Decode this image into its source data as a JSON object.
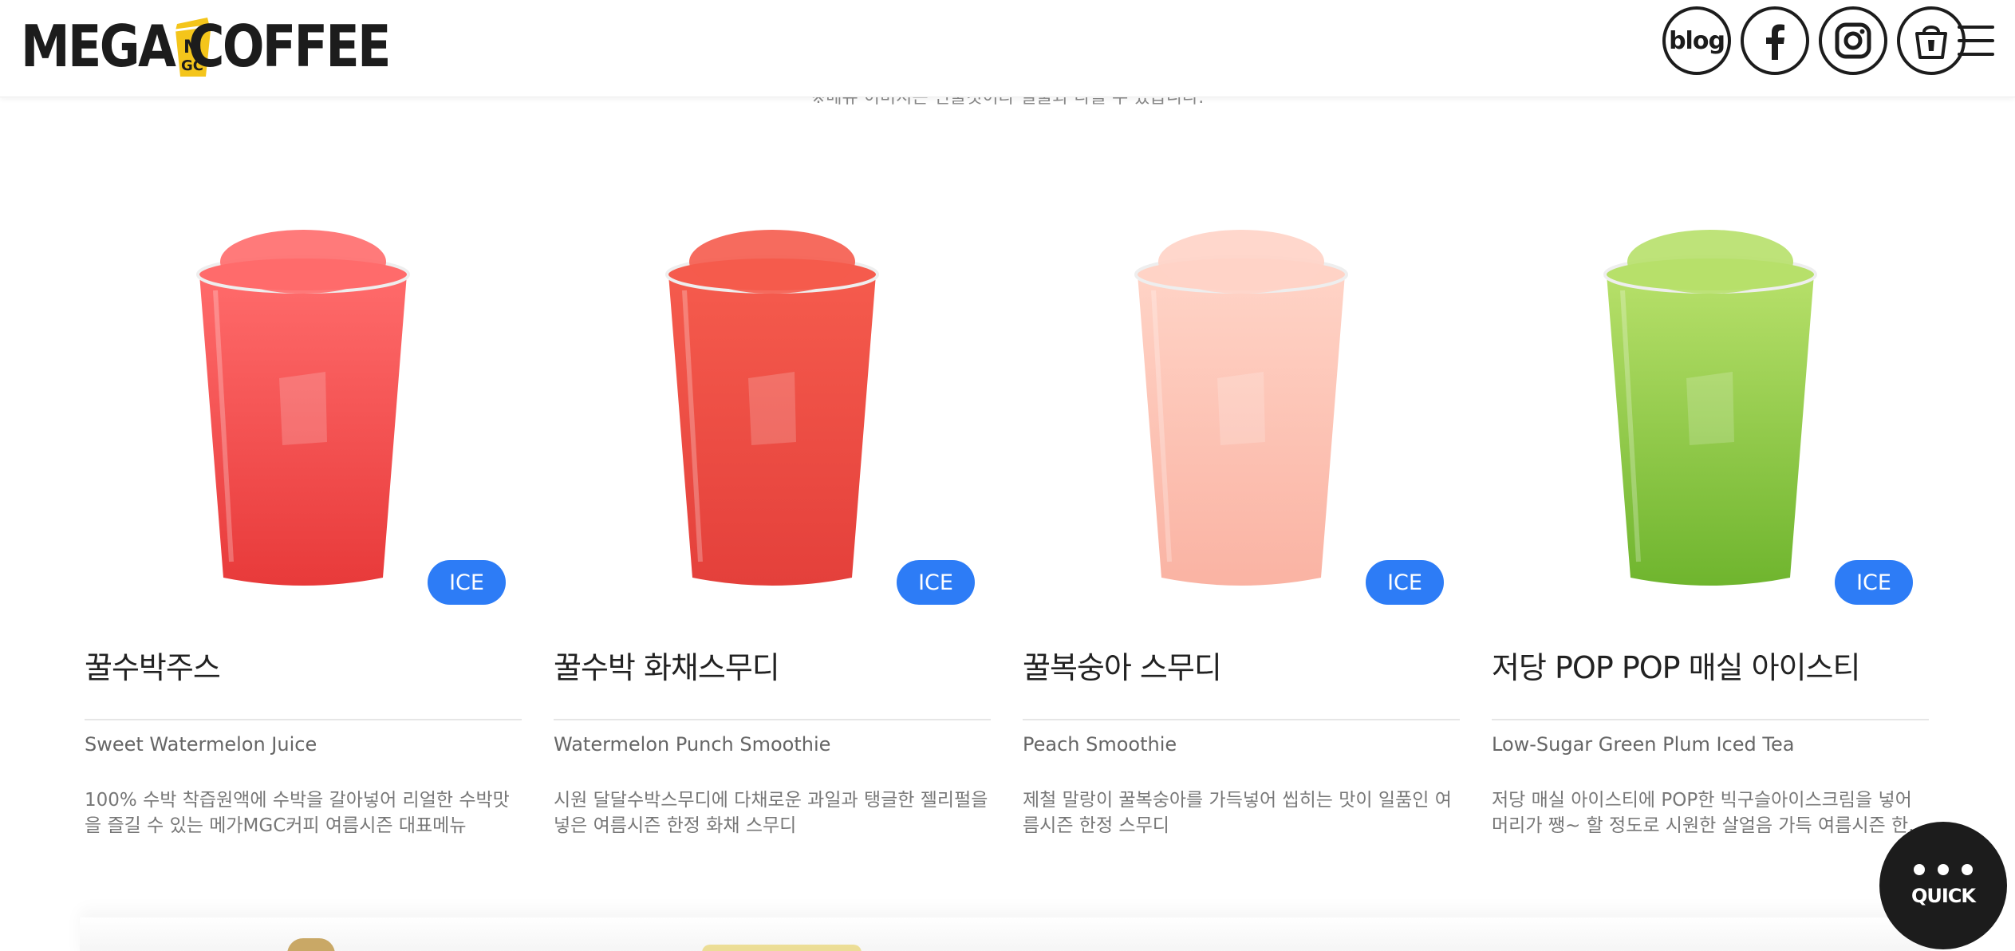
{
  "header": {
    "logo_left": "MEGA",
    "logo_right": "COFFEE",
    "logo_mark_text": "MGC",
    "blog_label": "blog",
    "icons": [
      "blog-icon",
      "facebook-icon",
      "instagram-icon",
      "cart-icon",
      "hamburger-menu-icon"
    ]
  },
  "notice": "※메뉴 이미지는 연출컷이라 실물과 다를 수 있습니다.",
  "products": [
    {
      "badge": "ICE",
      "name_ko": "꿀수박주스",
      "name_en": "Sweet Watermelon Juice",
      "desc": "100% 수박 착즙원액에 수박을 갈아넣어 리얼한 수박맛을 즐길 수 있는 메가MGC커피 여름시즌 대표메뉴",
      "color_top": "#ff6b6b",
      "color_bottom": "#e83a3a"
    },
    {
      "badge": "ICE",
      "name_ko": "꿀수박 화채스무디",
      "name_en": "Watermelon Punch Smoothie",
      "desc": "시원 달달수박스무디에 다채로운 과일과 탱글한 젤리펄을 넣은 여름시즌 한정 화채 스무디",
      "color_top": "#f55b4d",
      "color_bottom": "#e4403b"
    },
    {
      "badge": "ICE",
      "name_ko": "꿀복숭아 스무디",
      "name_en": "Peach Smoothie",
      "desc": "제철 말랑이 꿀복숭아를 가득넣어 씹히는 맛이 일품인 여름시즌 한정 스무디",
      "color_top": "#ffd3c6",
      "color_bottom": "#fab3a3"
    },
    {
      "badge": "ICE",
      "name_ko": "저당 POP POP 매실 아이스티",
      "name_en": "Low-Sugar Green Plum Iced Tea",
      "desc": "저당 매실 아이스티에 POP한 빅구슬아이스크림을 넣어 머리가 쨍~ 할 정도로 시원한 살얼음 가득 여름시즌 한정 메뉴",
      "color_top": "#b7e06a",
      "color_bottom": "#6fb52e"
    }
  ],
  "quick": {
    "label": "QUICK"
  },
  "colors": {
    "accent": "#2d7cf6",
    "dark": "#1c1c1c",
    "logo_yellow": "#f4c51b"
  }
}
